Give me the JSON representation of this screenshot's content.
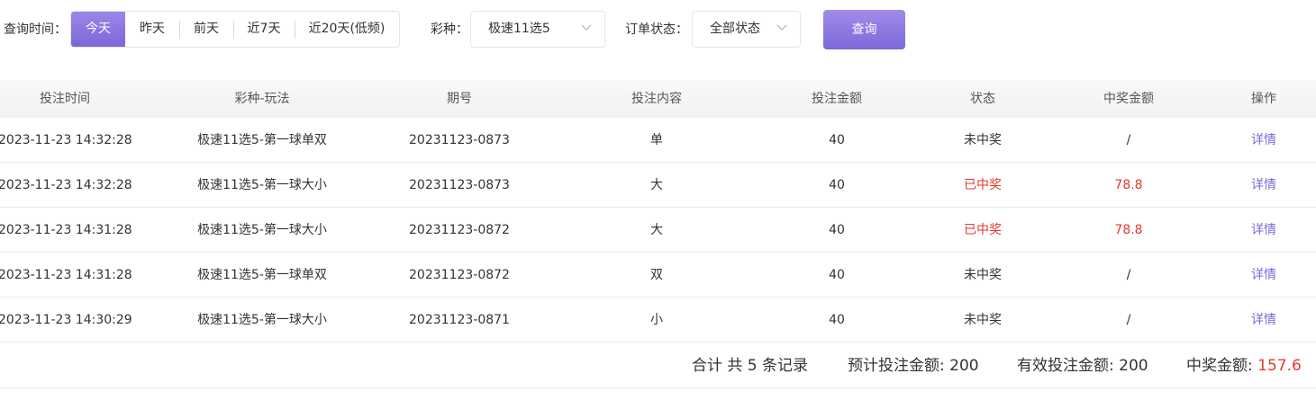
{
  "filters": {
    "query_time_label": "查询时间：",
    "date_options": [
      "今天",
      "昨天",
      "前天",
      "近7天",
      "近20天(低频)"
    ],
    "active_date": "今天",
    "lottery_label": "彩种：",
    "lottery_value": "极速11选5",
    "status_label": "订单状态：",
    "status_value": "全部状态",
    "query_button": "查询"
  },
  "table": {
    "headers": [
      "投注时间",
      "彩种-玩法",
      "期号",
      "投注内容",
      "投注金额",
      "状态",
      "中奖金额",
      "操作"
    ],
    "rows": [
      {
        "time": "2023-11-23 14:32:28",
        "game": "极速11选5-第一球单双",
        "period": "20231123-0873",
        "content": "单",
        "amount": "40",
        "status": "未中奖",
        "win": "/",
        "action": "详情",
        "won": false
      },
      {
        "time": "2023-11-23 14:32:28",
        "game": "极速11选5-第一球大小",
        "period": "20231123-0873",
        "content": "大",
        "amount": "40",
        "status": "已中奖",
        "win": "78.8",
        "action": "详情",
        "won": true
      },
      {
        "time": "2023-11-23 14:31:28",
        "game": "极速11选5-第一球大小",
        "period": "20231123-0872",
        "content": "大",
        "amount": "40",
        "status": "已中奖",
        "win": "78.8",
        "action": "详情",
        "won": true
      },
      {
        "time": "2023-11-23 14:31:28",
        "game": "极速11选5-第一球单双",
        "period": "20231123-0872",
        "content": "双",
        "amount": "40",
        "status": "未中奖",
        "win": "/",
        "action": "详情",
        "won": false
      },
      {
        "time": "2023-11-23 14:30:29",
        "game": "极速11选5-第一球大小",
        "period": "20231123-0871",
        "content": "小",
        "amount": "40",
        "status": "未中奖",
        "win": "/",
        "action": "详情",
        "won": false
      }
    ]
  },
  "summary": {
    "total_records": "合计 共 5 条记录",
    "expected_bet_label": "预计投注金额: ",
    "expected_bet": "200",
    "valid_bet_label": "有效投注金额: ",
    "valid_bet": "200",
    "win_label": "中奖金额: ",
    "win_amount": "157.6"
  },
  "colors": {
    "accent": "#7b68d8",
    "win_red": "#e23a2e"
  }
}
